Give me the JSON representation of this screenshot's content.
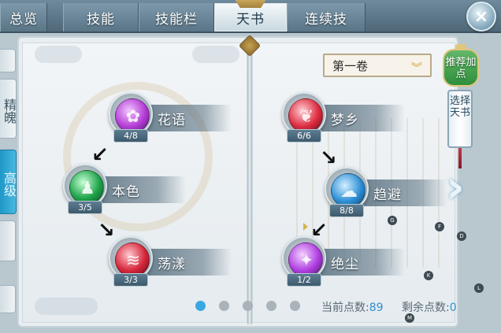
{
  "tabs": [
    {
      "label": "总览",
      "active": false
    },
    {
      "label": "技能",
      "active": false
    },
    {
      "label": "技能栏",
      "active": false
    },
    {
      "label": "天书",
      "active": true
    },
    {
      "label": "连续技",
      "active": false
    }
  ],
  "close_label": "×",
  "side_tabs": [
    {
      "label": "精魄",
      "selected": false
    },
    {
      "label": "高级",
      "selected": true
    }
  ],
  "volume": {
    "selected": "第一卷",
    "arrow_icon": "chevron-down-icon"
  },
  "recommend_button": "推荐加点",
  "choose_book_button": "选择天书",
  "next_page_icon": "chevron-right-icon",
  "left_tree": {
    "nodes": [
      {
        "name": "花语",
        "count": "4/8",
        "color": "#b43cd6"
      },
      {
        "name": "本色",
        "count": "3/5",
        "color": "#1fa34a"
      },
      {
        "name": "荡漾",
        "count": "3/3",
        "color": "#d6263a"
      }
    ]
  },
  "right_tree": {
    "nodes": [
      {
        "name": "梦乡",
        "count": "6/6",
        "color": "#dd2b3f"
      },
      {
        "name": "趋避",
        "count": "8/8",
        "color": "#2d8fd6"
      },
      {
        "name": "绝尘",
        "count": "1/2",
        "color": "#b03ee0"
      }
    ]
  },
  "pagination": {
    "total": 5,
    "current": 1
  },
  "points": {
    "current_label": "当前点数:",
    "current_value": "89",
    "remaining_label": "剩余点数:",
    "remaining_value": "0"
  },
  "floating_badges": [
    "G",
    "F",
    "D",
    "K",
    "L",
    "M"
  ],
  "colors": {
    "accent": "#3aa7e2",
    "tab_active_bg": "#e6eef2",
    "recommend_green": "#2f8f3c"
  }
}
